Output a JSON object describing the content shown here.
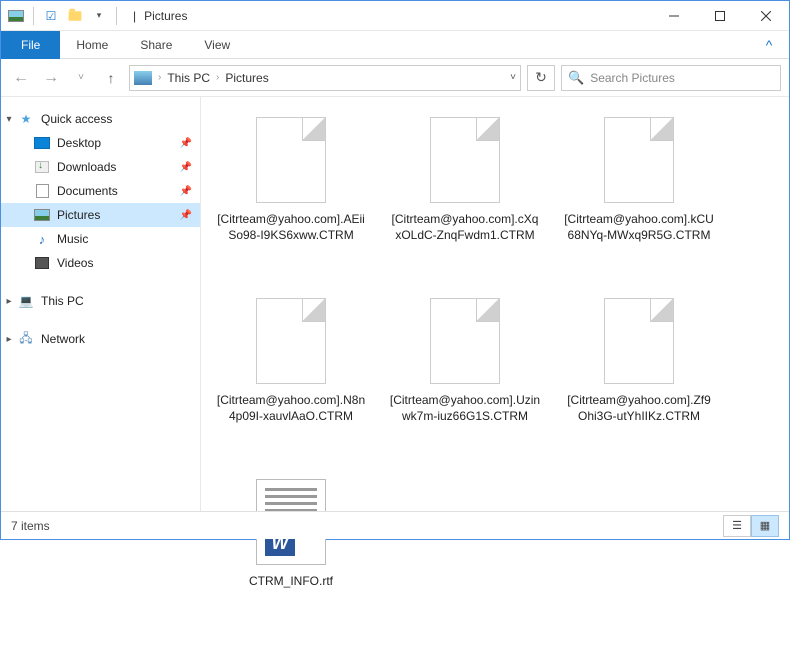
{
  "title": {
    "separator": "|",
    "location": "Pictures"
  },
  "ribbon": {
    "file": "File",
    "tabs": [
      "Home",
      "Share",
      "View"
    ]
  },
  "address": {
    "segments": [
      "This PC",
      "Pictures"
    ]
  },
  "search": {
    "placeholder": "Search Pictures"
  },
  "sidebar": {
    "quick_access": {
      "label": "Quick access",
      "items": [
        {
          "label": "Desktop",
          "pinned": true,
          "icon": "desktop"
        },
        {
          "label": "Downloads",
          "pinned": true,
          "icon": "downloads"
        },
        {
          "label": "Documents",
          "pinned": true,
          "icon": "documents"
        },
        {
          "label": "Pictures",
          "pinned": true,
          "icon": "pictures",
          "selected": true
        },
        {
          "label": "Music",
          "pinned": false,
          "icon": "music"
        },
        {
          "label": "Videos",
          "pinned": false,
          "icon": "videos"
        }
      ]
    },
    "this_pc": {
      "label": "This PC"
    },
    "network": {
      "label": "Network"
    }
  },
  "files": [
    {
      "name": "[Citrteam@yahoo.com].AEiiSo98-I9KS6xww.CTRM",
      "type": "blank"
    },
    {
      "name": "[Citrteam@yahoo.com].cXqxOLdC-ZnqFwdm1.CTRM",
      "type": "blank"
    },
    {
      "name": "[Citrteam@yahoo.com].kCU68NYq-MWxq9R5G.CTRM",
      "type": "blank"
    },
    {
      "name": "[Citrteam@yahoo.com].N8n4p09I-xauvlAaO.CTRM",
      "type": "blank"
    },
    {
      "name": "[Citrteam@yahoo.com].Uzinwk7m-iuz66G1S.CTRM",
      "type": "blank"
    },
    {
      "name": "[Citrteam@yahoo.com].Zf9Ohi3G-utYhIIKz.CTRM",
      "type": "blank"
    },
    {
      "name": "CTRM_INFO.rtf",
      "type": "rtf"
    }
  ],
  "status": {
    "count": "7 items"
  }
}
